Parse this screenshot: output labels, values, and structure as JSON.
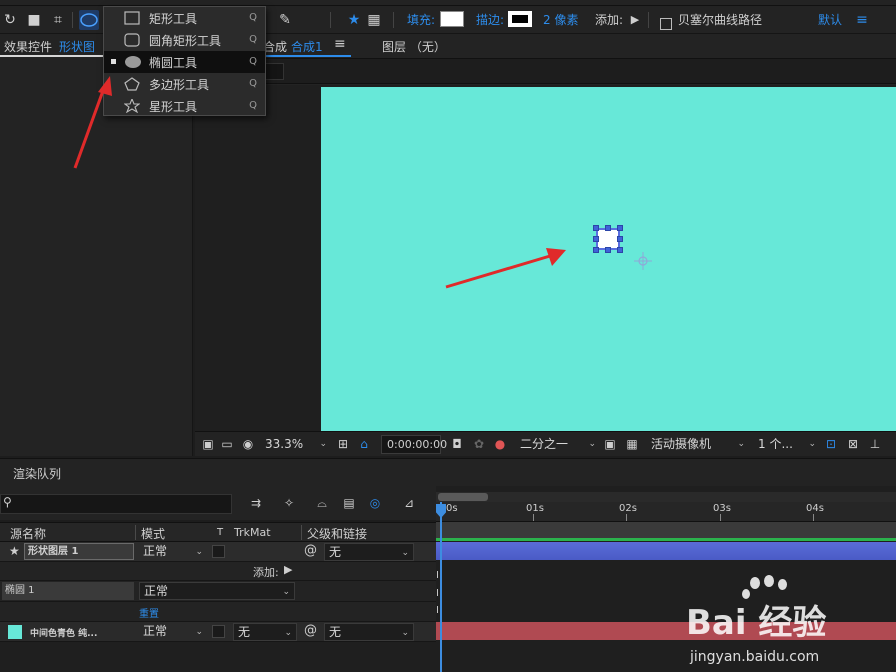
{
  "toolbar": {
    "fill_label": "填充:",
    "stroke_label": "描边:",
    "stroke_width": "2 像素",
    "add_label": "添加:",
    "bezier_label": "贝塞尔曲线路径",
    "workspace": "默认"
  },
  "shape_menu": {
    "items": [
      {
        "label": "矩形工具",
        "key": "Q"
      },
      {
        "label": "圆角矩形工具",
        "key": "Q"
      },
      {
        "label": "椭圆工具",
        "key": "Q"
      },
      {
        "label": "多边形工具",
        "key": "Q"
      },
      {
        "label": "星形工具",
        "key": "Q"
      }
    ],
    "selected_index": 2
  },
  "panels": {
    "effects_tab": "效果控件",
    "effects_target": "形状图",
    "comp_tab": "合成",
    "comp_name": "合成1",
    "layer_tab": "图层 （无）"
  },
  "viewer_footer": {
    "zoom": "33.3%",
    "timecode": "0:00:00:00",
    "resolution": "二分之一",
    "camera": "活动摄像机",
    "views": "1 个..."
  },
  "timeline": {
    "render_queue_tab": "渲染队列",
    "columns": {
      "source_name": "源名称",
      "mode": "模式",
      "t": "T",
      "trkmat": "TrkMat",
      "parent": "父级和链接"
    },
    "ruler": [
      "0s",
      "01s",
      "02s",
      "03s",
      "04s"
    ],
    "layers": [
      {
        "name": "形状图层 1",
        "mode": "正常",
        "parent": "无"
      },
      {
        "add_label": "添加:"
      },
      {
        "name": "椭圆 1",
        "mode": "正常"
      },
      {
        "reset_label": "重置"
      },
      {
        "name": "中间色青色 纯...",
        "mode": "正常",
        "trkmat": "无",
        "parent": "无"
      }
    ]
  },
  "watermark": {
    "brand": "Bai 经验",
    "url": "jingyan.baidu.com"
  },
  "colors": {
    "canvas": "#67e8d8",
    "accent_blue": "#2d8ceb",
    "shape_bar": "#5a6cd8",
    "solid_bar": "#b04a52",
    "annotation_red": "#e02a2a"
  }
}
